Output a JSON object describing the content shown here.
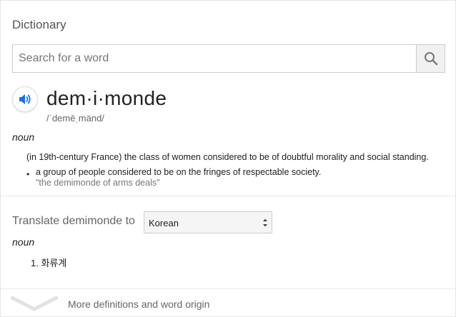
{
  "header": {
    "title": "Dictionary"
  },
  "search": {
    "placeholder": "Search for a word",
    "value": ""
  },
  "entry": {
    "headword": "dem·i·monde",
    "phonetic": "/ˈdemēˌmänd/",
    "part_of_speech": "noun",
    "definition": "(in 19th-century France) the class of women considered to be of doubtful morality and social standing.",
    "subdefinition": "a group of people considered to be on the fringes of respectable society.",
    "example": "\"the demimonde of arms deals\""
  },
  "translate": {
    "label": "Translate demimonde to",
    "language": "Korean",
    "part_of_speech": "noun",
    "items": [
      {
        "number": "1.",
        "text": "화류계"
      }
    ]
  },
  "footer": {
    "more_label": "More definitions and word origin"
  },
  "colors": {
    "accent": "#1a73e8",
    "icon_grey": "#777777"
  }
}
